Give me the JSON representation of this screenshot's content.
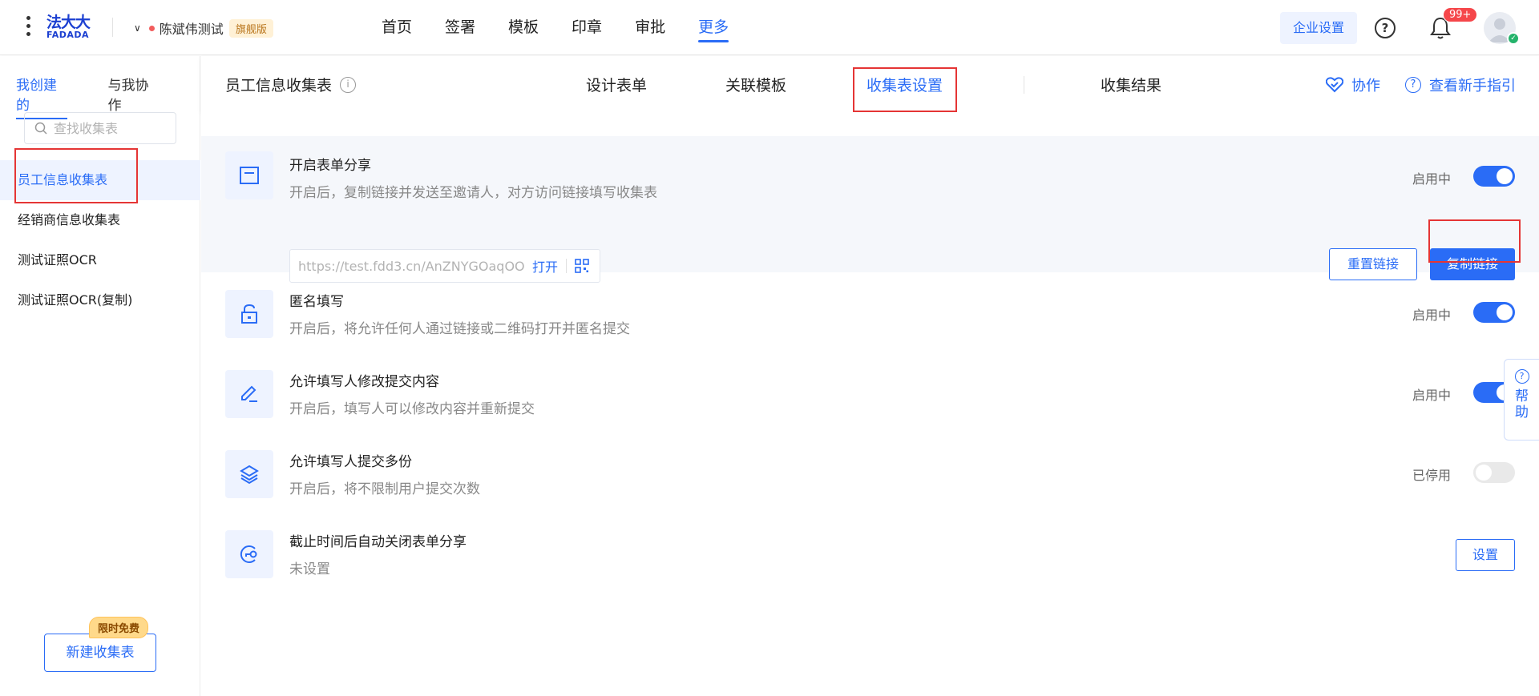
{
  "header": {
    "logo_cn": "法大大",
    "logo_en": "FADADA",
    "tenant_name": "陈斌伟测试",
    "tenant_badge": "旗舰版",
    "nav": [
      {
        "label": "首页",
        "active": false
      },
      {
        "label": "签署",
        "active": false
      },
      {
        "label": "模板",
        "active": false
      },
      {
        "label": "印章",
        "active": false
      },
      {
        "label": "审批",
        "active": false
      },
      {
        "label": "更多",
        "active": true
      }
    ],
    "enterprise_settings": "企业设置",
    "notification_count": "99+",
    "accent_color": "#2a6cf6"
  },
  "sidebar": {
    "tabs": [
      "我创建的",
      "与我协作"
    ],
    "search_placeholder": "查找收集表",
    "items": [
      "员工信息收集表",
      "经销商信息收集表",
      "测试证照OCR",
      "测试证照OCR(复制)"
    ],
    "new_button": "新建收集表",
    "free_badge": "限时免费"
  },
  "subheader": {
    "title": "员工信息收集表",
    "tabs": [
      "设计表单",
      "关联模板",
      "收集表设置",
      "收集结果"
    ],
    "active_tab": "收集表设置",
    "collaborate": "协作",
    "guide": "查看新手指引"
  },
  "settings": [
    {
      "title": "开启表单分享",
      "desc": "开启后，复制链接并发送至邀请人，对方访问链接填写收集表",
      "status": "启用中",
      "enabled": true,
      "link": "https://test.fdd3.cn/AnZNYGOaqOO",
      "open_label": "打开",
      "reset_label": "重置链接",
      "copy_label": "复制链接"
    },
    {
      "title": "匿名填写",
      "desc": "开启后，将允许任何人通过链接或二维码打开并匿名提交",
      "status": "启用中",
      "enabled": true
    },
    {
      "title": "允许填写人修改提交内容",
      "desc": "开启后，填写人可以修改内容并重新提交",
      "status": "启用中",
      "enabled": true
    },
    {
      "title": "允许填写人提交多份",
      "desc": "开启后，将不限制用户提交次数",
      "status": "已停用",
      "enabled": false
    },
    {
      "title": "截止时间后自动关闭表单分享",
      "desc": "未设置",
      "button": "设置"
    }
  ],
  "help_float": "帮助"
}
